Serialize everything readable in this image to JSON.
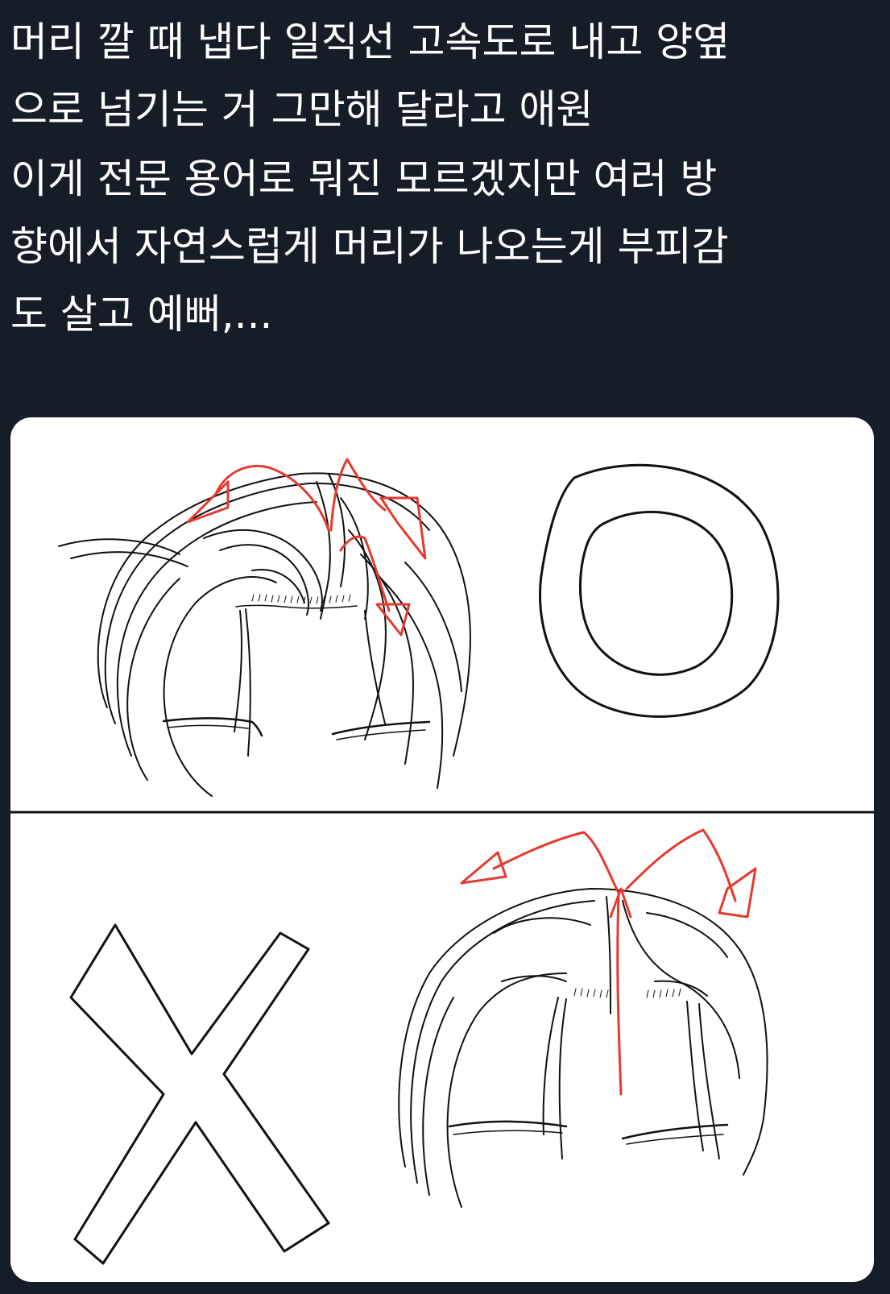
{
  "tweet": {
    "lines": [
      "머리 깔 때 냅다 일직선 고속도로 내고 양옆",
      "으로 넘기는 거 그만해 달라고 애원",
      "이게 전문 용어로 뭐진 모르겠지만 여러 방",
      "향에서 자연스럽게 머리가 나오는게 부피감",
      "도 살고 예뻐,..."
    ]
  },
  "media": {
    "panels": [
      {
        "mark": "O"
      },
      {
        "mark": "X"
      }
    ]
  },
  "colors": {
    "background": "#151d29",
    "text": "#ffffff",
    "card": "#ffffff",
    "sketch": "#111111",
    "arrow": "#e53a2e"
  }
}
